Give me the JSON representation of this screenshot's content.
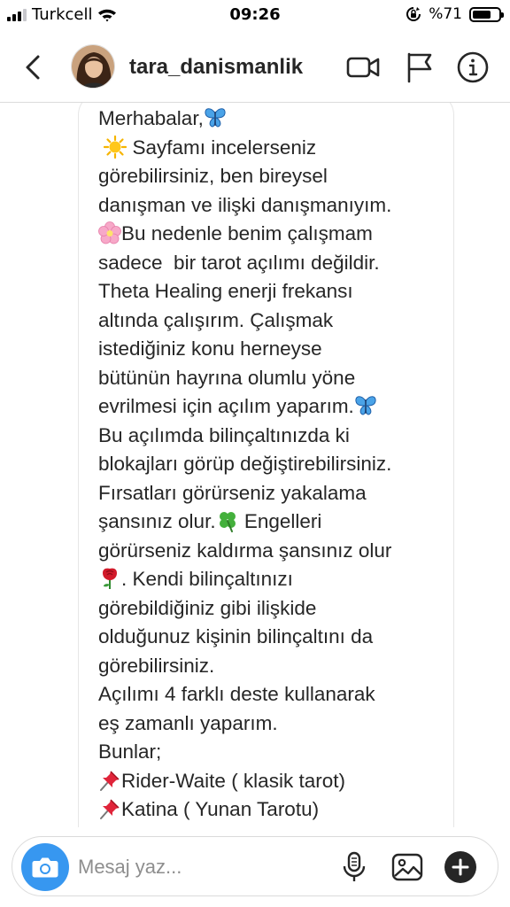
{
  "status_bar": {
    "carrier": "Turkcell",
    "time": "09:26",
    "battery": "%71",
    "battery_level": 0.71
  },
  "header": {
    "username": "tara_danismanlik",
    "icons": [
      "back-chevron-icon",
      "video-camera-icon",
      "flag-icon",
      "info-icon"
    ]
  },
  "message": {
    "lines": [
      "Merhabalar,",
      " Sayfamı incelerseniz",
      "görebilirsiniz, ben bireysel",
      "danışman ve ilişki danışmanıyım.",
      "Bu nedenle benim çalışmam",
      "sadece  bir tarot açılımı değildir.",
      "Theta Healing enerji frekansı",
      "altında çalışırım. Çalışmak",
      "istediğiniz konu herneyse",
      "bütünün hayrına olumlu yöne",
      "evrilmesi için açılım yaparım.",
      "Bu açılımda bilinçaltınızda ki",
      "blokajları görüp değiştirebilirsiniz.",
      "Fırsatları görürseniz yakalama",
      "şansınız olur.",
      " Engelleri",
      "görürseniz kaldırma şansınız olur",
      ". Kendi bilinçaltınızı",
      "görebildiğiniz gibi ilişkide",
      "olduğunuz kişinin bilinçaltını da",
      "görebilirsiniz.",
      "Açılımı 4 farklı deste kullanarak",
      "eş zamanlı yaparım.",
      "Bunlar;",
      "Rider-Waite ( klasik tarot)",
      "Katina ( Yunan Tarotu)"
    ],
    "emojis": [
      "butterfly-icon",
      "sun-icon",
      "cherry-blossom-icon",
      "four-leaf-clover-icon",
      "rose-icon",
      "pushpin-icon"
    ]
  },
  "composer": {
    "placeholder": "Mesaj yaz...",
    "icons": [
      "camera-icon",
      "microphone-icon",
      "gallery-icon",
      "plus-icon"
    ]
  },
  "colors": {
    "accent": "#3797f0",
    "text": "#262626",
    "placeholder": "#8e8e8e",
    "border": "#dbdbdb"
  }
}
